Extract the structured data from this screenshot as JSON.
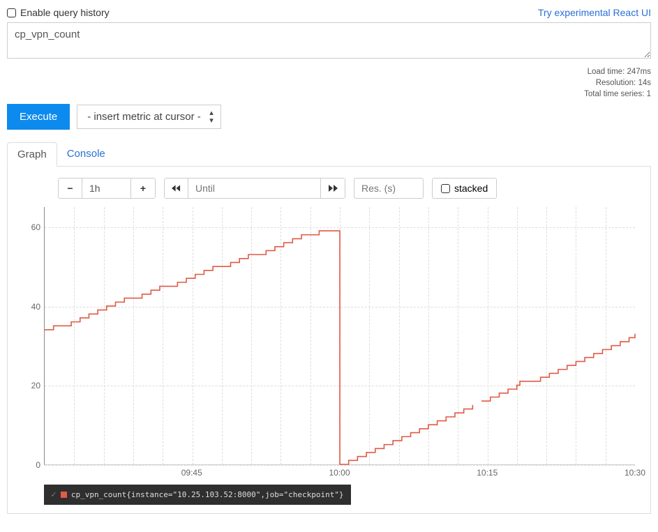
{
  "header": {
    "enable_history_label": "Enable query history",
    "react_link": "Try experimental React UI"
  },
  "query": {
    "expression": "cp_vpn_count"
  },
  "meta": {
    "load_time": "Load time: 247ms",
    "resolution": "Resolution: 14s",
    "total_series": "Total time series: 1"
  },
  "toolbar": {
    "execute_label": "Execute",
    "metric_placeholder": "- insert metric at cursor -"
  },
  "tabs": {
    "graph": "Graph",
    "console": "Console"
  },
  "controls": {
    "range": {
      "minus": "−",
      "value": "1h",
      "plus": "+"
    },
    "until": {
      "back": "◀◀",
      "placeholder": "Until",
      "fwd": "▶▶"
    },
    "res_placeholder": "Res. (s)",
    "stacked_label": "stacked"
  },
  "legend": {
    "label": "cp_vpn_count{instance=\"10.25.103.52:8000\",job=\"checkpoint\"}"
  },
  "chart_data": {
    "type": "line",
    "title": "",
    "xlabel": "",
    "ylabel": "",
    "y_ticks": [
      0,
      20,
      40,
      60
    ],
    "ylim": [
      0,
      65
    ],
    "x_ticks": [
      "09:45",
      "10:00",
      "10:15",
      "10:30"
    ],
    "x_tick_values": [
      0.25,
      0.5,
      0.75,
      1.0
    ],
    "color": "#e05a45",
    "series": [
      {
        "name": "cp_vpn_count{instance=\"10.25.103.52:8000\",job=\"checkpoint\"}",
        "points": [
          {
            "x": 0.0,
            "y": 34
          },
          {
            "x": 0.015,
            "y": 35
          },
          {
            "x": 0.03,
            "y": 35
          },
          {
            "x": 0.045,
            "y": 36
          },
          {
            "x": 0.06,
            "y": 37
          },
          {
            "x": 0.075,
            "y": 38
          },
          {
            "x": 0.09,
            "y": 39
          },
          {
            "x": 0.105,
            "y": 40
          },
          {
            "x": 0.12,
            "y": 41
          },
          {
            "x": 0.135,
            "y": 42
          },
          {
            "x": 0.15,
            "y": 42
          },
          {
            "x": 0.165,
            "y": 43
          },
          {
            "x": 0.18,
            "y": 44
          },
          {
            "x": 0.195,
            "y": 45
          },
          {
            "x": 0.21,
            "y": 45
          },
          {
            "x": 0.225,
            "y": 46
          },
          {
            "x": 0.24,
            "y": 47
          },
          {
            "x": 0.255,
            "y": 48
          },
          {
            "x": 0.27,
            "y": 49
          },
          {
            "x": 0.285,
            "y": 50
          },
          {
            "x": 0.3,
            "y": 50
          },
          {
            "x": 0.315,
            "y": 51
          },
          {
            "x": 0.33,
            "y": 52
          },
          {
            "x": 0.345,
            "y": 53
          },
          {
            "x": 0.36,
            "y": 53
          },
          {
            "x": 0.375,
            "y": 54
          },
          {
            "x": 0.39,
            "y": 55
          },
          {
            "x": 0.405,
            "y": 56
          },
          {
            "x": 0.42,
            "y": 57
          },
          {
            "x": 0.435,
            "y": 58
          },
          {
            "x": 0.45,
            "y": 58
          },
          {
            "x": 0.465,
            "y": 59
          },
          {
            "x": 0.48,
            "y": 59
          },
          {
            "x": 0.495,
            "y": 59
          },
          {
            "x": 0.5,
            "y": 0
          },
          {
            "x": 0.515,
            "y": 1
          },
          {
            "x": 0.53,
            "y": 2
          },
          {
            "x": 0.545,
            "y": 3
          },
          {
            "x": 0.56,
            "y": 4
          },
          {
            "x": 0.575,
            "y": 5
          },
          {
            "x": 0.59,
            "y": 6
          },
          {
            "x": 0.605,
            "y": 7
          },
          {
            "x": 0.62,
            "y": 8
          },
          {
            "x": 0.635,
            "y": 9
          },
          {
            "x": 0.65,
            "y": 10
          },
          {
            "x": 0.665,
            "y": 11
          },
          {
            "x": 0.68,
            "y": 12
          },
          {
            "x": 0.695,
            "y": 13
          },
          {
            "x": 0.71,
            "y": 14
          },
          {
            "x": 0.725,
            "y": 15
          },
          {
            "x": 0.74,
            "y": 16
          },
          {
            "x": 0.755,
            "y": 17
          },
          {
            "x": 0.77,
            "y": 18
          },
          {
            "x": 0.785,
            "y": 19
          },
          {
            "x": 0.8,
            "y": 20
          },
          {
            "x": 0.805,
            "y": 21
          },
          {
            "x": 0.825,
            "y": 21
          },
          {
            "x": 0.84,
            "y": 22
          },
          {
            "x": 0.855,
            "y": 23
          },
          {
            "x": 0.87,
            "y": 24
          },
          {
            "x": 0.885,
            "y": 25
          },
          {
            "x": 0.9,
            "y": 26
          },
          {
            "x": 0.915,
            "y": 27
          },
          {
            "x": 0.93,
            "y": 28
          },
          {
            "x": 0.945,
            "y": 29
          },
          {
            "x": 0.96,
            "y": 30
          },
          {
            "x": 0.975,
            "y": 31
          },
          {
            "x": 0.99,
            "y": 32
          },
          {
            "x": 1.0,
            "y": 33
          }
        ],
        "gap_after_index": 49
      }
    ]
  }
}
